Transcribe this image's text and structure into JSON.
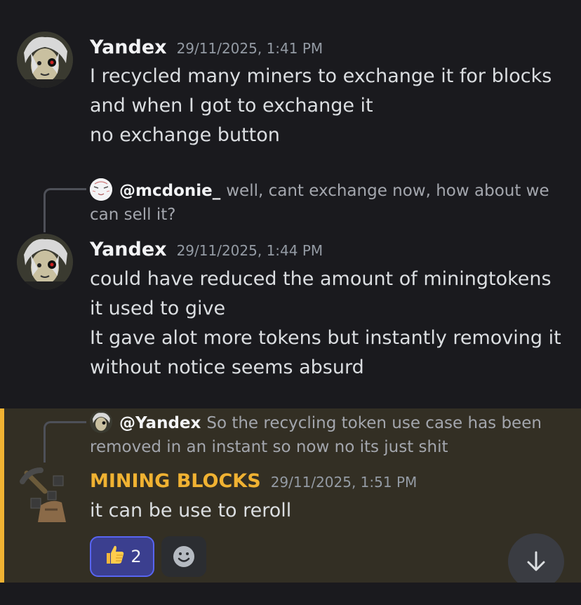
{
  "messages": [
    {
      "author": "Yandex",
      "timestamp": "29/11/2025, 1:41 PM",
      "lines": [
        "I recycled many miners to exchange it for blocks",
        "and when I got to exchange it",
        "no exchange button"
      ]
    },
    {
      "reply": {
        "author": "@mcdonie_",
        "text": "well, cant exchange now, how about we can sell it?"
      },
      "author": "Yandex",
      "timestamp": "29/11/2025, 1:44 PM",
      "lines": [
        "could have reduced the amount of miningtokens",
        "it used to give",
        "It gave alot more tokens but instantly removing it",
        "without notice seems absurd"
      ]
    },
    {
      "reply": {
        "author": "@Yandex",
        "text": "So the recycling token use case has been removed in an instant so now no its just shit"
      },
      "author": "MINING BLOCKS",
      "author_color": "#f0b232",
      "timestamp": "29/11/2025, 1:51 PM",
      "lines": [
        "it can be use to reroll"
      ],
      "reactions": [
        {
          "emoji": "👍",
          "icon": "thumbs-up-icon",
          "count": "2",
          "selected": true
        }
      ]
    }
  ],
  "colors": {
    "background": "#1a1a1e",
    "highlight_bg": "#332f24",
    "highlight_bar": "#f0b232",
    "reaction_selected_bg": "#3b3f8f",
    "reaction_selected_border": "#5865f2"
  }
}
